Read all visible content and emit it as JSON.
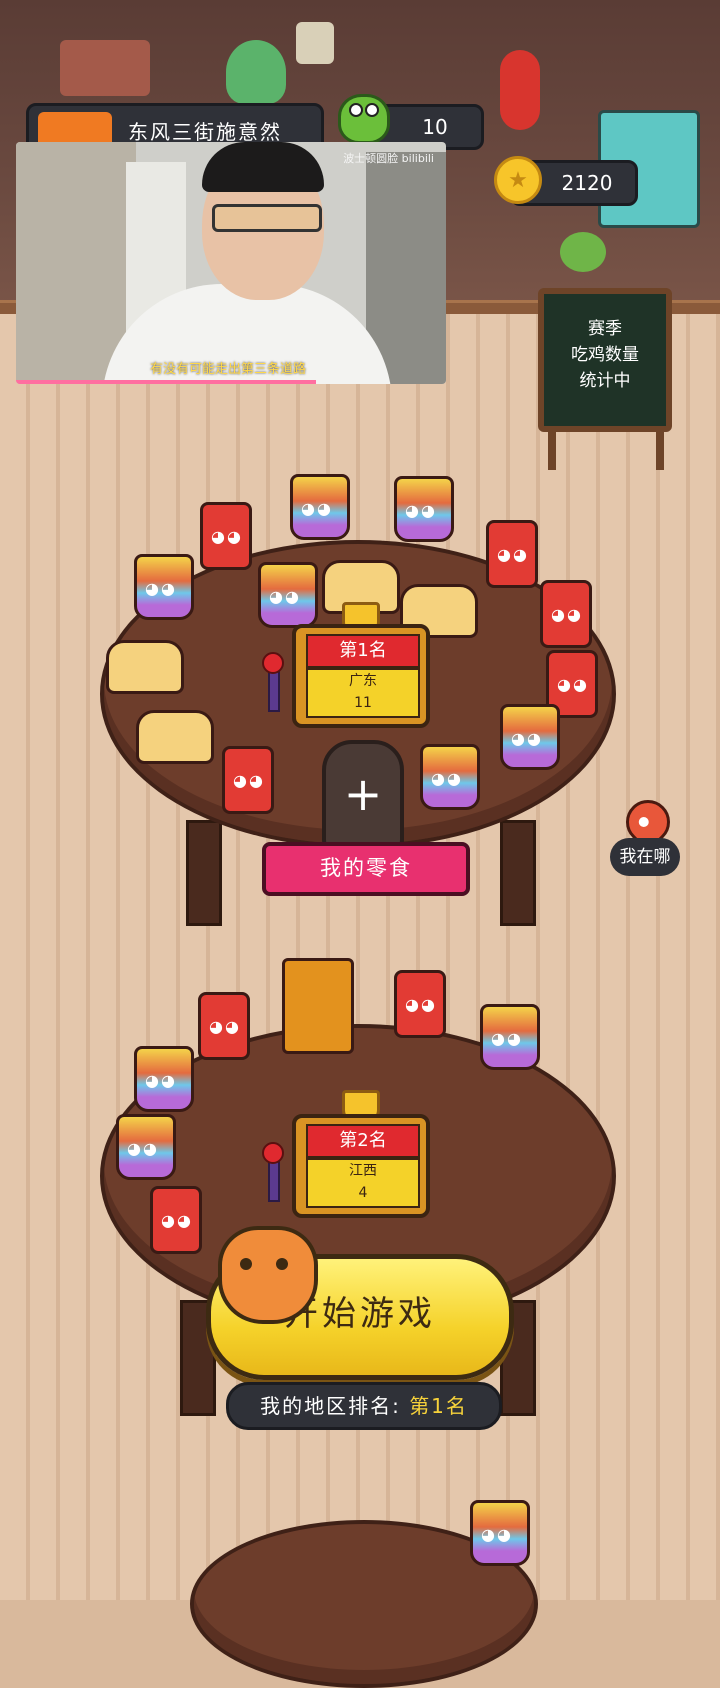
{
  "player": {
    "name": "东风三街施意然",
    "frogs": "10",
    "coins": "2120"
  },
  "video": {
    "watermark": "波士顿圆脸 bilibili",
    "subtitle": "有没有可能走出第三条道路"
  },
  "board": {
    "line1": "赛季",
    "line2": "吃鸡数量",
    "line3": "统计中"
  },
  "tables": [
    {
      "rank": "第1名",
      "region": "广东",
      "count": "11"
    },
    {
      "rank": "第2名",
      "region": "江西",
      "count": "4"
    }
  ],
  "my_snacks_label": "我的零食",
  "add_symbol": "+",
  "locate_label": "我在哪",
  "start_label": "开始游戏",
  "region_rank": {
    "label": "我的地区排名:",
    "value": "第1名"
  },
  "colors": {
    "accent_yellow": "#f5d22a",
    "rank_red": "#e0292f",
    "ribbon_pink": "#e8306f",
    "pill_dark": "#2f3138"
  }
}
